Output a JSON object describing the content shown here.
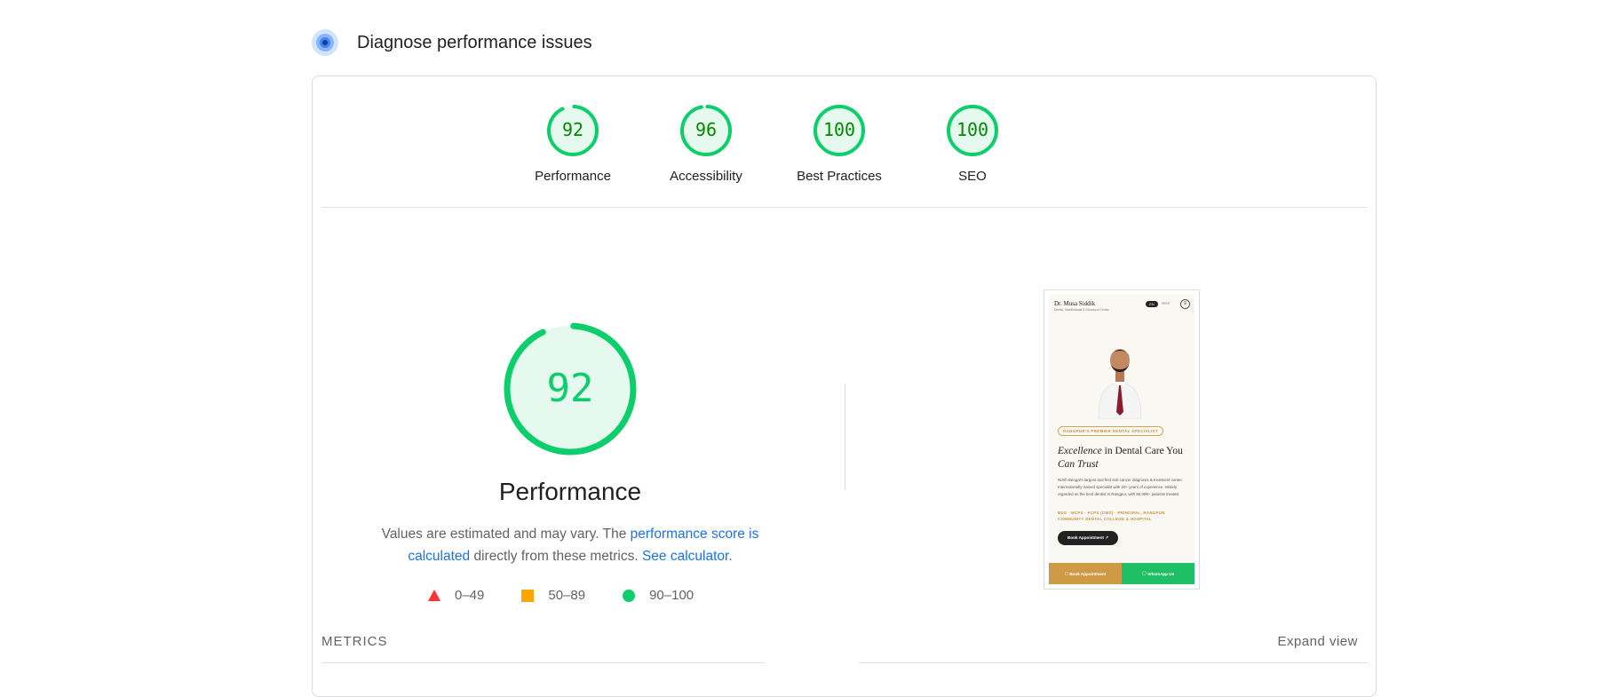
{
  "header": {
    "title": "Diagnose performance issues"
  },
  "categories": [
    {
      "label": "Performance",
      "score": "92",
      "value": 92
    },
    {
      "label": "Accessibility",
      "score": "96",
      "value": 96
    },
    {
      "label": "Best Practices",
      "score": "100",
      "value": 100
    },
    {
      "label": "SEO",
      "score": "100",
      "value": 100
    }
  ],
  "main": {
    "score": "92",
    "score_value": 92,
    "title": "Performance",
    "desc_prefix": "Values are estimated and may vary. The ",
    "desc_link1": "performance score is calculated",
    "desc_mid": " directly from these metrics. ",
    "desc_link2": "See calculator",
    "desc_suffix": "."
  },
  "legend": [
    {
      "range": "0–49"
    },
    {
      "range": "50–89"
    },
    {
      "range": "90–100"
    }
  ],
  "metrics": {
    "label": "METRICS",
    "expand_label": "Expand view"
  },
  "screenshot": {
    "brand": "Dr. Musa Siddik",
    "brand_sub": "Dental, Maxillofacial & Structural Center",
    "lang_on": "EN",
    "lang_off": "বাংলা",
    "badge": "RANGPUR'S PREMIER DENTAL SPECIALIST",
    "headline_em1": "Excellence",
    "headline_mid": " in Dental Care You ",
    "headline_em2": "Can Trust",
    "body": "North Bengal's largest and first oral cancer diagnosis & treatment center. Internationally trained specialist with 20+ years of experience. Widely regarded as the best dentist in Rangpur, with 50,000+ patients treated.",
    "quals": "BDS · MCPS · FCPS (OMS) · PRINCIPAL, RANGPUR COMMUNITY DENTAL COLLEGE & HOSPITAL",
    "cta": "Book Appointment ↗",
    "book_btn": "Book Appointment",
    "wa_btn": "WhatsApp Us"
  },
  "colors": {
    "pass": "#0cce6b",
    "pass_text": "#008800",
    "pass_fill": "#e6f9ee",
    "average": "#ffa400",
    "fail": "#ff3333",
    "link": "#1a73e8"
  }
}
